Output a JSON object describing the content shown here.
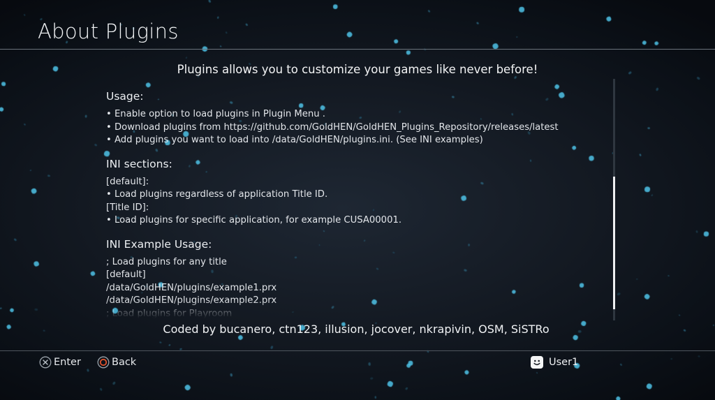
{
  "header": {
    "title": "About Plugins"
  },
  "tagline": "Plugins allows you to customize your games like never before!",
  "usage": {
    "heading": "Usage:",
    "items": [
      "• Enable option to load plugins in Plugin Menu .",
      "• Download plugins from https://github.com/GoldHEN/GoldHEN_Plugins_Repository/releases/latest",
      "• Add plugins you want to load into /data/GoldHEN/plugins.ini. (See INI examples)"
    ]
  },
  "ini_sections": {
    "heading": "INI sections:",
    "lines": [
      "[default]:",
      "• Load plugins regardless of application Title ID.",
      "[Title ID]:",
      "• Load plugins for specific application, for example CUSA00001."
    ]
  },
  "ini_example": {
    "heading": "INI Example Usage:",
    "lines": [
      "; Load plugins for any title",
      "[default]",
      "/data/GoldHEN/plugins/example1.prx",
      "/data/GoldHEN/plugins/example2.prx",
      "; Load plugins for Playroom"
    ]
  },
  "credits": "Coded by bucanero, ctn123, illusion, jocover, nkrapivin, OSM, SiSTRo",
  "footer": {
    "enter_label": "Enter",
    "enter_icon": "cross-button-icon",
    "back_label": "Back",
    "back_icon": "circle-button-icon",
    "back_icon_color": "#e0522c",
    "user_label": "User1",
    "user_icon": "user-avatar-icon"
  },
  "colors": {
    "particle": "#4fc3e8",
    "accent_text": "#f0f2f4"
  }
}
